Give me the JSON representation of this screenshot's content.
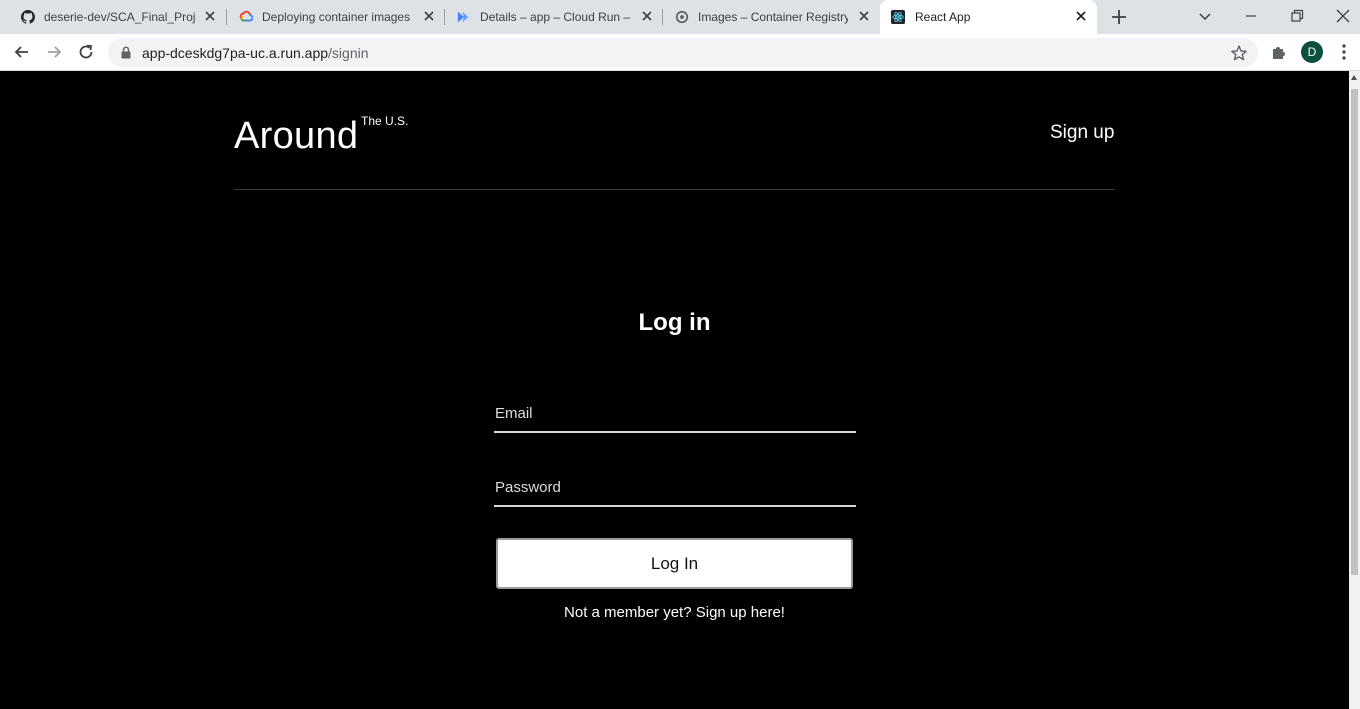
{
  "browser": {
    "tabs": [
      {
        "title": "deserie-dev/SCA_Final_Proje",
        "icon": "github-icon"
      },
      {
        "title": "Deploying container images",
        "icon": "google-cloud-icon"
      },
      {
        "title": "Details – app – Cloud Run – S",
        "icon": "cloud-run-icon"
      },
      {
        "title": "Images – Container Registry",
        "icon": "container-registry-icon"
      },
      {
        "title": "React App",
        "icon": "react-icon"
      }
    ],
    "url_host": "app-dceskdg7pa-uc.a.run.app",
    "url_path": "/signin",
    "profile_initial": "D"
  },
  "header": {
    "logo": "Around",
    "logo_sup": "The U.S.",
    "signup": "Sign up"
  },
  "login": {
    "title": "Log in",
    "email_placeholder": "Email",
    "password_placeholder": "Password",
    "button": "Log In",
    "member_text": "Not a member yet? Sign up here!"
  }
}
